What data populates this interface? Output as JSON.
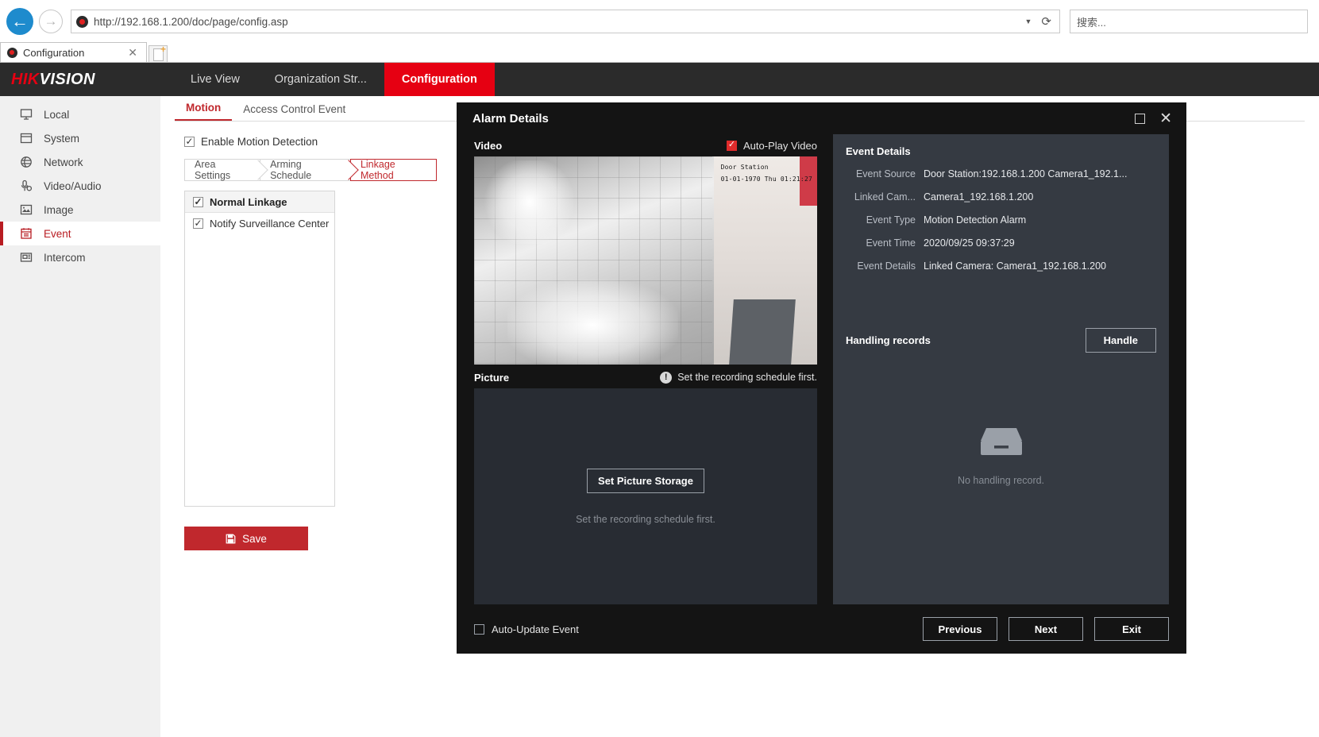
{
  "browser": {
    "url": "http://192.168.1.200/doc/page/config.asp",
    "tab_title": "Configuration",
    "search_placeholder": "搜索...",
    "back_icon": "back-arrow-icon",
    "forward_icon": "forward-arrow-icon",
    "reload_icon": "reload-icon",
    "dropdown_icon": "chevron-down-icon"
  },
  "header": {
    "logo_first": "HIK",
    "logo_second": "VISION",
    "nav": [
      {
        "label": "Live View",
        "active": false
      },
      {
        "label": "Organization Str...",
        "active": false
      },
      {
        "label": "Configuration",
        "active": true
      }
    ]
  },
  "sidebar": {
    "items": [
      {
        "label": "Local",
        "icon": "monitor-icon",
        "active": false
      },
      {
        "label": "System",
        "icon": "window-icon",
        "active": false
      },
      {
        "label": "Network",
        "icon": "globe-icon",
        "active": false
      },
      {
        "label": "Video/Audio",
        "icon": "microphone-icon",
        "active": false
      },
      {
        "label": "Image",
        "icon": "picture-icon",
        "active": false
      },
      {
        "label": "Event",
        "icon": "calendar-icon",
        "active": true
      },
      {
        "label": "Intercom",
        "icon": "intercom-icon",
        "active": false
      }
    ]
  },
  "content": {
    "tabs": [
      {
        "label": "Motion",
        "active": true
      },
      {
        "label": "Access Control Event",
        "active": false
      }
    ],
    "enable_motion_label": "Enable Motion Detection",
    "enable_motion_checked": true,
    "steps": [
      {
        "label": "Area Settings",
        "active": false
      },
      {
        "label": "Arming Schedule",
        "active": false
      },
      {
        "label": "Linkage Method",
        "active": true
      }
    ],
    "linkage": {
      "header_label": "Normal Linkage",
      "header_checked": true,
      "items": [
        {
          "label": "Notify Surveillance Center",
          "checked": true
        }
      ]
    },
    "save_label": "Save",
    "save_icon": "floppy-disk-icon",
    "accent_color": "#c0282d"
  },
  "modal": {
    "title": "Alarm Details",
    "maximize_icon": "maximize-icon",
    "close_icon": "close-icon",
    "video": {
      "section_label": "Video",
      "auto_play_label": "Auto-Play Video",
      "auto_play_checked": true,
      "osd_line1": "Door Station",
      "osd_line2": "01-01-1970 Thu 01:21:27"
    },
    "picture": {
      "section_label": "Picture",
      "warning_icon": "exclamation-icon",
      "warning_text": "Set the recording schedule first.",
      "set_storage_label": "Set Picture Storage",
      "note_text": "Set the recording schedule first."
    },
    "event_details": {
      "title": "Event Details",
      "rows": [
        {
          "label": "Event Source",
          "value": "Door Station:192.168.1.200 Camera1_192.1..."
        },
        {
          "label": "Linked Cam...",
          "value": "Camera1_192.168.1.200"
        },
        {
          "label": "Event Type",
          "value": "Motion Detection Alarm"
        },
        {
          "label": "Event Time",
          "value": "2020/09/25 09:37:29"
        },
        {
          "label": "Event Details",
          "value": "Linked Camera: Camera1_192.168.1.200"
        }
      ]
    },
    "handling": {
      "title": "Handling records",
      "handle_label": "Handle",
      "empty_icon": "inbox-tray-icon",
      "empty_text": "No handling record."
    },
    "footer": {
      "auto_update_label": "Auto-Update Event",
      "auto_update_checked": false,
      "buttons": [
        {
          "label": "Previous"
        },
        {
          "label": "Next"
        },
        {
          "label": "Exit"
        }
      ]
    }
  }
}
